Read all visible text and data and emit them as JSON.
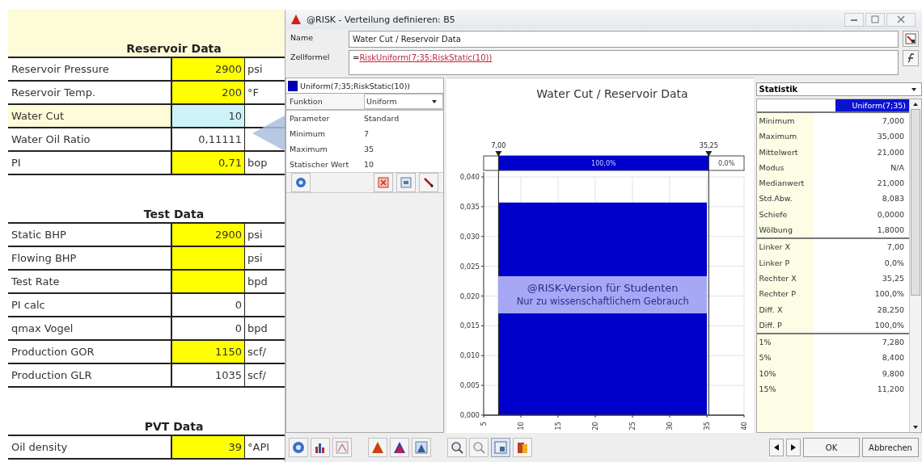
{
  "sheet": {
    "sections": [
      {
        "title": "Reservoir Data",
        "shaded": true,
        "rows": [
          {
            "label": "Reservoir Pressure",
            "value": "2900",
            "unit": "psi",
            "kind": "input",
            "selected": false
          },
          {
            "label": "Reservoir Temp.",
            "value": "200",
            "unit": "°F",
            "kind": "input",
            "selected": false
          },
          {
            "label": "Water Cut",
            "value": "10",
            "unit": "",
            "kind": "input",
            "selected": true
          },
          {
            "label": "Water Oil Ratio",
            "value": "0,11111",
            "unit": "",
            "kind": "calc",
            "selected": false
          },
          {
            "label": "PI",
            "value": "0,71",
            "unit": "bop",
            "kind": "input",
            "selected": false
          }
        ]
      },
      {
        "title": "Test Data",
        "shaded": false,
        "rows": [
          {
            "label": "Static BHP",
            "value": "2900",
            "unit": "psi",
            "kind": "input",
            "selected": false
          },
          {
            "label": "Flowing BHP",
            "value": "",
            "unit": "psi",
            "kind": "input",
            "selected": false
          },
          {
            "label": "Test Rate",
            "value": "",
            "unit": "bpd",
            "kind": "input",
            "selected": false
          },
          {
            "label": "PI calc",
            "value": "0",
            "unit": "",
            "kind": "calc",
            "selected": false
          },
          {
            "label": "qmax Vogel",
            "value": "0",
            "unit": "bpd",
            "kind": "calc",
            "selected": false
          },
          {
            "label": "Production GOR",
            "value": "1150",
            "unit": "scf/",
            "kind": "input",
            "selected": false
          },
          {
            "label": "Production GLR",
            "value": "1035",
            "unit": "scf/",
            "kind": "calc",
            "selected": false
          }
        ]
      },
      {
        "title": "PVT Data",
        "shaded": false,
        "rows": [
          {
            "label": "Oil density",
            "value": "39",
            "unit": "°API",
            "kind": "input",
            "selected": false
          }
        ]
      }
    ]
  },
  "dialog": {
    "title": "@RISK - Verteilung definieren: B5",
    "name_label": "Name",
    "name_value": "Water Cut / Reservoir Data",
    "formula_label": "Zellformel",
    "formula": {
      "prefix": "=",
      "reference": "RiskUniform(7;35;RiskStatic(10))"
    },
    "distribution": {
      "header": "Uniform(7;35;RiskStatic(10))",
      "function_label": "Funktion",
      "function_value": "Uniform",
      "parameters": [
        {
          "label": "Parameter",
          "value": "Standard"
        },
        {
          "label": "Minimum",
          "value": "7"
        },
        {
          "label": "Maximum",
          "value": "35"
        },
        {
          "label": "Statischer Wert",
          "value": "10"
        }
      ]
    },
    "chart": {
      "chart_data": {
        "type": "area",
        "title": "Water Cut / Reservoir Data",
        "x": [
          7,
          35
        ],
        "series": [
          {
            "name": "Uniform(7;35)",
            "color": "#0000cc",
            "values": [
              0.0357,
              0.0357
            ]
          }
        ],
        "xlim": [
          5,
          40
        ],
        "ylim": [
          0,
          0.04
        ],
        "grid": true,
        "ref_lines": [
          {
            "axis": "x",
            "value": 7,
            "label": "7,00"
          },
          {
            "axis": "x",
            "value": 35.25,
            "label": "35,25"
          }
        ],
        "xticks": [
          5,
          10,
          15,
          20,
          25,
          30,
          35,
          40
        ],
        "yticks": [
          {
            "value": 0,
            "label": "0,000"
          },
          {
            "value": 0.005,
            "label": "0,005"
          },
          {
            "value": 0.01,
            "label": "0,010"
          },
          {
            "value": 0.015,
            "label": "0,015"
          },
          {
            "value": 0.02,
            "label": "0,020"
          },
          {
            "value": 0.025,
            "label": "0,025"
          },
          {
            "value": 0.03,
            "label": "0,030"
          },
          {
            "value": 0.035,
            "label": "0,035"
          },
          {
            "value": 0.04,
            "label": "0,040"
          }
        ]
      },
      "delimiters": {
        "inside": "100,0%",
        "outside": "0,0%"
      },
      "notice": [
        "@RISK-Version für Studenten",
        "Nur zu wissenschaftlichem Gebrauch"
      ]
    },
    "statistics": {
      "selector": "Statistik",
      "groups": [
        [
          {
            "label": "Minimum",
            "value": "7,000"
          },
          {
            "label": "Maximum",
            "value": "35,000"
          },
          {
            "label": "Mittelwert",
            "value": "21,000"
          },
          {
            "label": "Modus",
            "value": "N/A"
          },
          {
            "label": "Medianwert",
            "value": "21,000"
          },
          {
            "label": "Std.Abw.",
            "value": "8,083"
          },
          {
            "label": "Schiefe",
            "value": "0,0000"
          },
          {
            "label": "Wölbung",
            "value": "1,8000"
          }
        ],
        [
          {
            "label": "Linker X",
            "value": "7,00"
          },
          {
            "label": "Linker P",
            "value": "0,0%"
          },
          {
            "label": "Rechter X",
            "value": "35,25"
          },
          {
            "label": "Rechter P",
            "value": "100,0%"
          },
          {
            "label": "Diff. X",
            "value": "28,250"
          },
          {
            "label": "Diff. P",
            "value": "100,0%"
          }
        ],
        [
          {
            "label": "1%",
            "value": "7,280"
          },
          {
            "label": "5%",
            "value": "8,400"
          },
          {
            "label": "10%",
            "value": "9,800"
          },
          {
            "label": "15%",
            "value": "11,200"
          }
        ]
      ]
    },
    "buttons": {
      "ok": "OK",
      "cancel": "Abbrechen"
    }
  }
}
